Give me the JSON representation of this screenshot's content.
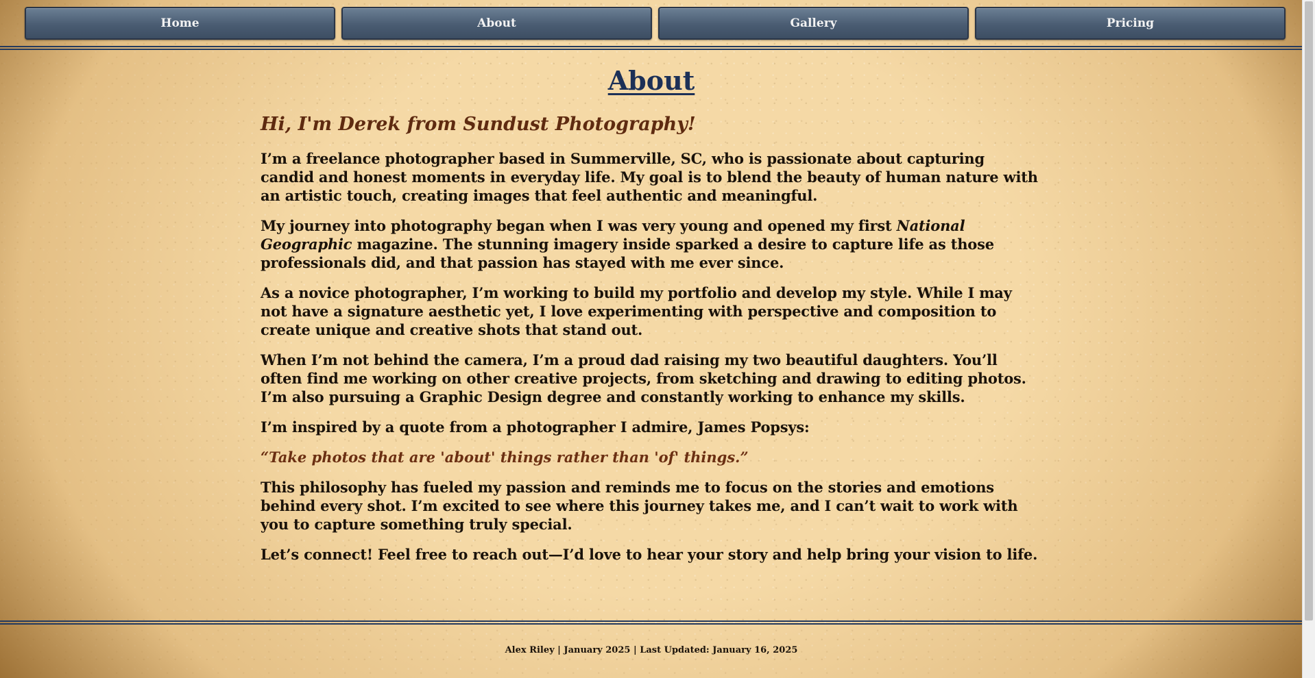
{
  "nav": {
    "items": [
      {
        "label": "Home"
      },
      {
        "label": "About"
      },
      {
        "label": "Gallery"
      },
      {
        "label": "Pricing"
      }
    ]
  },
  "main": {
    "title": "About",
    "greeting": "Hi, I'm Derek from Sundust Photography!",
    "paragraphs": {
      "p1": "I’m a freelance photographer based in Summerville, SC, who is passionate about capturing candid and honest moments in everyday life. My goal is to blend the beauty of human nature with an artistic touch, creating images that feel authentic and meaningful.",
      "p2_before": "My journey into photography began when I was very young and opened my first ",
      "p2_italic": "National Geographic",
      "p2_after": " magazine. The stunning imagery inside sparked a desire to capture life as those professionals did, and that passion has stayed with me ever since.",
      "p3": "As a novice photographer, I’m working to build my portfolio and develop my style. While I may not have a signature aesthetic yet, I love experimenting with perspective and composition to create unique and creative shots that stand out.",
      "p4": "When I’m not behind the camera, I’m a proud dad raising my two beautiful daughters. You’ll often find me working on other creative projects, from sketching and drawing to editing photos. I’m also pursuing a Graphic Design degree and constantly working to enhance my skills.",
      "p5": "I’m inspired by a quote from a photographer I admire, James Popsys:",
      "quote": "“Take photos that are 'about' things rather than 'of' things.”",
      "p6": "This philosophy has fueled my passion and reminds me to focus on the stories and emotions behind every shot. I’m excited to see where this journey takes me, and I can’t wait to work with you to capture something truly special.",
      "p7": "Let’s connect! Feel free to reach out—I’d love to hear your story and help bring your vision to life."
    }
  },
  "footer": {
    "text": "Alex Riley | January 2025 | Last Updated: January 16, 2025"
  },
  "colors": {
    "nav_button": "#4a5c72",
    "rule": "#243a5e",
    "title": "#1c3057",
    "greeting": "#5e2a10",
    "background": "#f5d9a6"
  }
}
